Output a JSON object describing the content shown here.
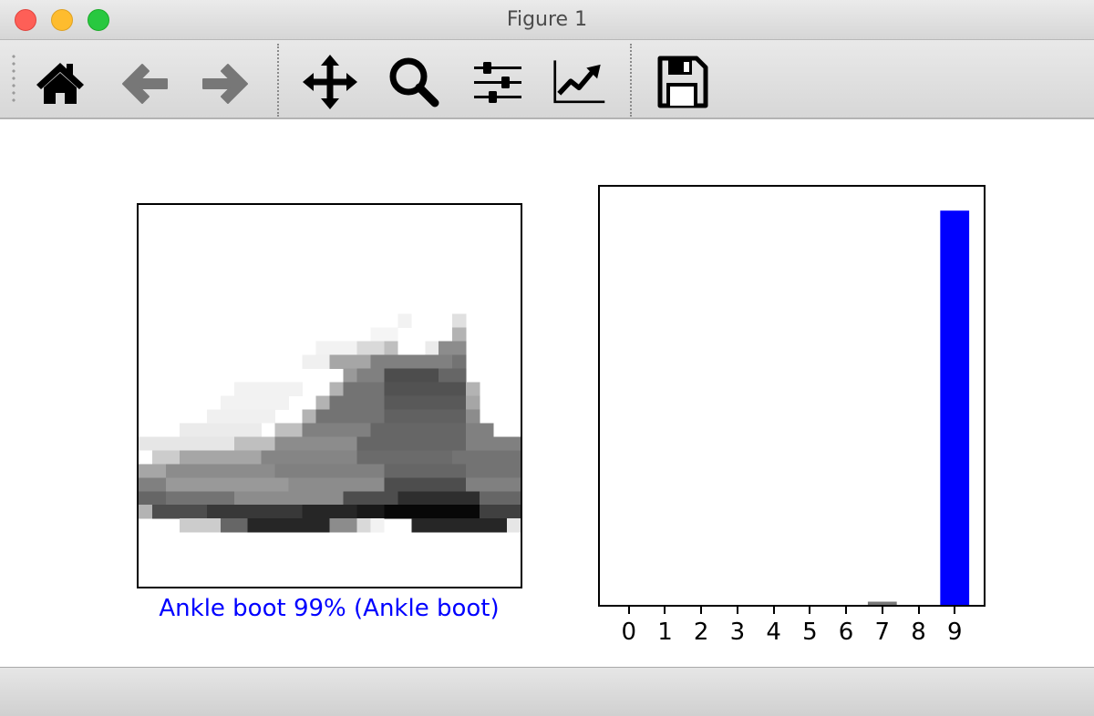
{
  "window": {
    "title": "Figure 1"
  },
  "toolbar": {
    "buttons": [
      {
        "icon": "home-icon",
        "tooltip": "Home"
      },
      {
        "icon": "back-arrow-icon",
        "tooltip": "Back",
        "disabled": true
      },
      {
        "icon": "forward-arrow-icon",
        "tooltip": "Forward",
        "disabled": true
      },
      {
        "icon": "pan-icon",
        "tooltip": "Pan"
      },
      {
        "icon": "zoom-icon",
        "tooltip": "Zoom"
      },
      {
        "icon": "subplots-icon",
        "tooltip": "Subplots"
      },
      {
        "icon": "customize-icon",
        "tooltip": "Customize"
      },
      {
        "icon": "save-icon",
        "tooltip": "Save"
      }
    ]
  },
  "figure": {
    "image_panel": {
      "caption": "Ankle boot 99% (Ankle boot)",
      "caption_color": "#0000ff",
      "colormap": "binary"
    },
    "chart_data": {
      "type": "bar",
      "categories": [
        "0",
        "1",
        "2",
        "3",
        "4",
        "5",
        "6",
        "7",
        "8",
        "9"
      ],
      "values": [
        0.0,
        0.0,
        0.0,
        0.0,
        0.0,
        0.0,
        0.0,
        0.008,
        0.0,
        0.99
      ],
      "ylim": [
        0,
        1
      ],
      "default_color": "#777777",
      "highlight_index": 9,
      "highlight_color": "#0000ff",
      "title": "",
      "xlabel": "",
      "ylabel": "",
      "grid": false,
      "show_yticks": false
    }
  }
}
